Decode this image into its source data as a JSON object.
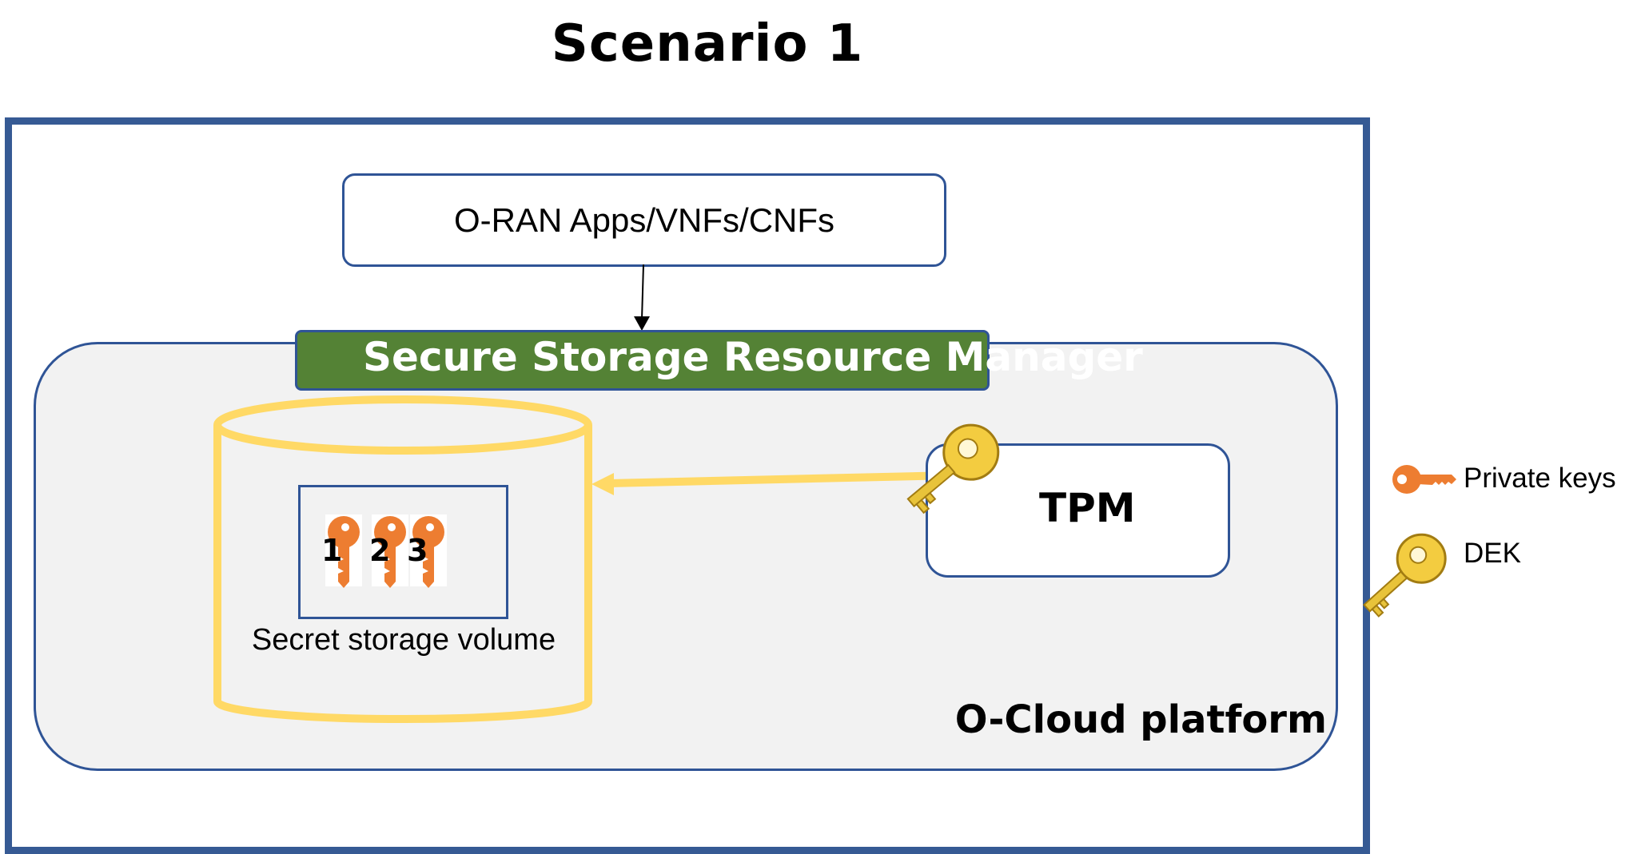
{
  "title": "Scenario 1",
  "apps_label": "O-RAN Apps/VNFs/CNFs",
  "ssrm_label": "Secure Storage Resource Manager",
  "ocloud_label": "O-Cloud platform",
  "tpm_label": "TPM",
  "volume_label": "Secret storage volume",
  "key_numbers": [
    "1",
    "2",
    "3"
  ],
  "legend": {
    "private_keys": "Private keys",
    "dek": "DEK"
  },
  "colors": {
    "frame": "#365a94",
    "ssrm_fill": "#548235",
    "cylinder": "#ffd966",
    "private_key": "#ed7d31",
    "dek": "#e8c33a"
  }
}
